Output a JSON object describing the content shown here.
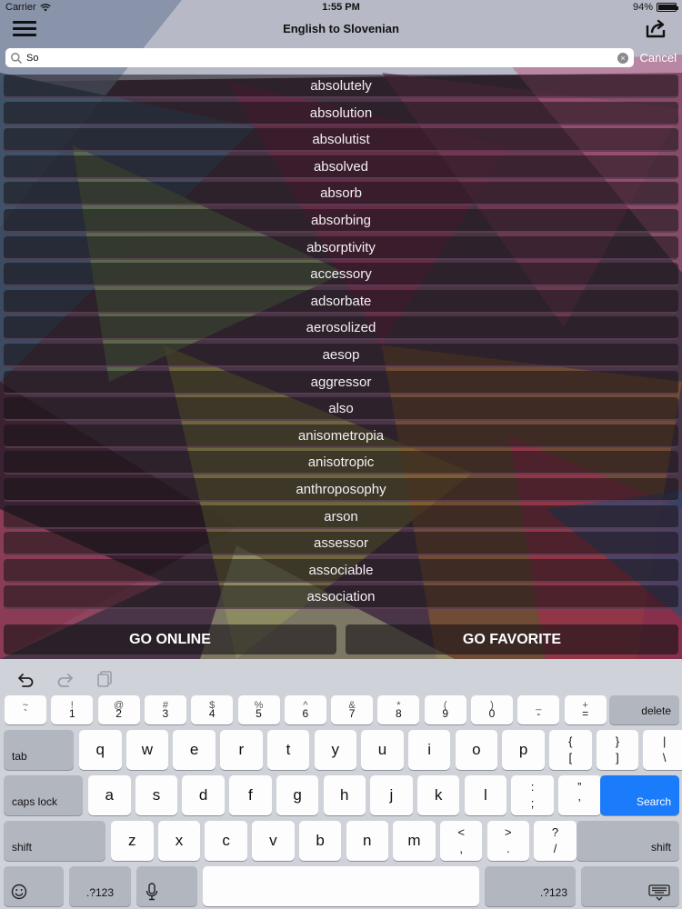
{
  "status_bar": {
    "carrier": "Carrier",
    "time": "1:55 PM",
    "battery_text": "94%",
    "battery_level": 0.94
  },
  "nav": {
    "title": "English to Slovenian",
    "menu_icon": "hamburger-icon",
    "share_icon": "share-icon"
  },
  "search": {
    "value": "So",
    "cancel_label": "Cancel"
  },
  "words": [
    "absolutely",
    "absolution",
    "absolutist",
    "absolved",
    "absorb",
    "absorbing",
    "absorptivity",
    "accessory",
    "adsorbate",
    "aerosolized",
    "aesop",
    "aggressor",
    "also",
    "anisometropia",
    "anisotropic",
    "anthroposophy",
    "arson",
    "assessor",
    "associable",
    "association"
  ],
  "buttons": {
    "go_online": "GO ONLINE",
    "go_favorite": "GO FAVORITE"
  },
  "keyboard": {
    "number_row": [
      {
        "top": "~",
        "bottom": "`"
      },
      {
        "top": "!",
        "bottom": "1"
      },
      {
        "top": "@",
        "bottom": "2"
      },
      {
        "top": "#",
        "bottom": "3"
      },
      {
        "top": "$",
        "bottom": "4"
      },
      {
        "top": "%",
        "bottom": "5"
      },
      {
        "top": "^",
        "bottom": "6"
      },
      {
        "top": "&",
        "bottom": "7"
      },
      {
        "top": "*",
        "bottom": "8"
      },
      {
        "top": "(",
        "bottom": "9"
      },
      {
        "top": ")",
        "bottom": "0"
      },
      {
        "top": "_",
        "bottom": "-"
      },
      {
        "top": "+",
        "bottom": "="
      }
    ],
    "delete": "delete",
    "tab": "tab",
    "row_q": [
      "q",
      "w",
      "e",
      "r",
      "t",
      "y",
      "u",
      "i",
      "o",
      "p"
    ],
    "row_q_symbols": [
      {
        "top": "{",
        "bottom": "["
      },
      {
        "top": "}",
        "bottom": "]"
      },
      {
        "top": "|",
        "bottom": "\\"
      }
    ],
    "caps_lock": "caps lock",
    "row_a": [
      "a",
      "s",
      "d",
      "f",
      "g",
      "h",
      "j",
      "k",
      "l"
    ],
    "row_a_symbols": [
      {
        "top": ":",
        "bottom": ";"
      },
      {
        "top": "”",
        "bottom": "’"
      }
    ],
    "search_key": "Search",
    "shift": "shift",
    "row_z": [
      "z",
      "x",
      "c",
      "v",
      "b",
      "n",
      "m"
    ],
    "row_z_symbols": [
      {
        "top": "<",
        "bottom": ","
      },
      {
        "top": ">",
        "bottom": "."
      },
      {
        "top": "?",
        "bottom": "/"
      }
    ],
    "numbers_key": ".?123",
    "emoji_icon": "emoji-icon",
    "mic_icon": "microphone-icon",
    "hide_keyboard_icon": "keyboard-hide-icon",
    "undo_icon": "undo-icon",
    "redo_icon": "redo-icon",
    "paste_icon": "paste-icon",
    "accent_color": "#1a7bfb"
  }
}
